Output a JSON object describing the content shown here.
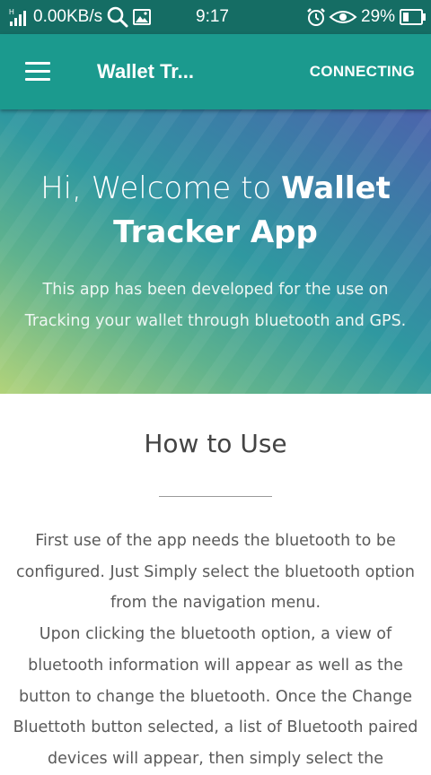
{
  "status_bar": {
    "network_speed": "0.00KB/s",
    "time": "9:17",
    "battery": "29%",
    "signal_label": "H"
  },
  "app_bar": {
    "title": "Wallet Tr...",
    "action": "CONNECTING"
  },
  "hero": {
    "title_light": "Hi, Welcome to ",
    "title_bold_1": "Wallet",
    "title_bold_2": "Tracker App",
    "subtitle": "This app has been developed for the use on Tracking your wallet through bluetooth and GPS."
  },
  "how_to_use": {
    "title": "How to Use",
    "paragraph_1": "First use of the app needs the bluetooth to be configured. Just Simply select the bluetooth option from the navigation menu.",
    "paragraph_2": "Upon clicking the bluetooth option, a view of bluetooth information will appear as well as the button to change the bluetooth. Once the Change Bluettoth button selected, a list of Bluetooth paired devices will appear, then simply select the"
  },
  "colors": {
    "status_bar": "#156d64",
    "app_bar": "#1b9a8e",
    "hero_start": "#b2d37a",
    "hero_end": "#4c63ac"
  }
}
